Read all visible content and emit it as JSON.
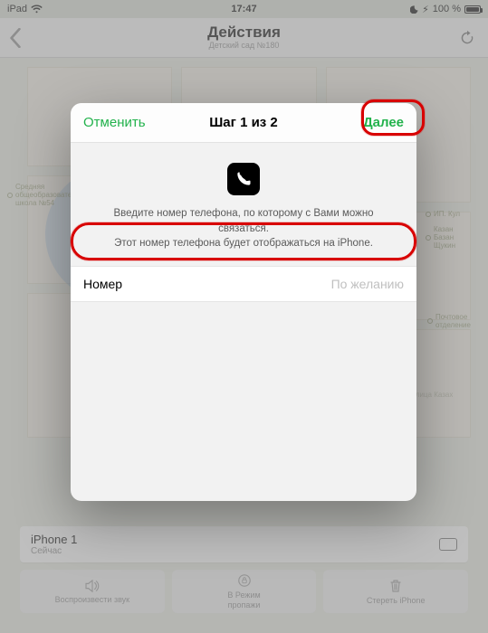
{
  "statusbar": {
    "carrier": "iPad",
    "wifi": true,
    "time": "17:47",
    "moon": true,
    "battery_pct": "100 %"
  },
  "nav": {
    "title": "Действия",
    "subtitle": "Детский сад №180"
  },
  "map": {
    "poi1": "Средняя\nобщеобразовательная\nшкола №54",
    "poi2": "ИП. Кул",
    "poi3": "Казан\nБазан\nЩукин",
    "poi4": "Почтовое\nотделение",
    "street": "улица Казах"
  },
  "device_card": {
    "name": "iPhone 1",
    "status": "Сейчас"
  },
  "toolbar": {
    "play_label": "Воспроизвести звук",
    "lost_label1": "В Режим",
    "lost_label2": "пропажи",
    "erase_label": "Стереть iPhone"
  },
  "modal": {
    "cancel": "Отменить",
    "title": "Шаг 1 из 2",
    "next": "Далее",
    "desc_line1": "Введите номер телефона, по которому с Вами можно связаться.",
    "desc_line2": "Этот номер телефона будет отображаться на iPhone.",
    "field_label": "Номер",
    "placeholder": "По желанию"
  }
}
